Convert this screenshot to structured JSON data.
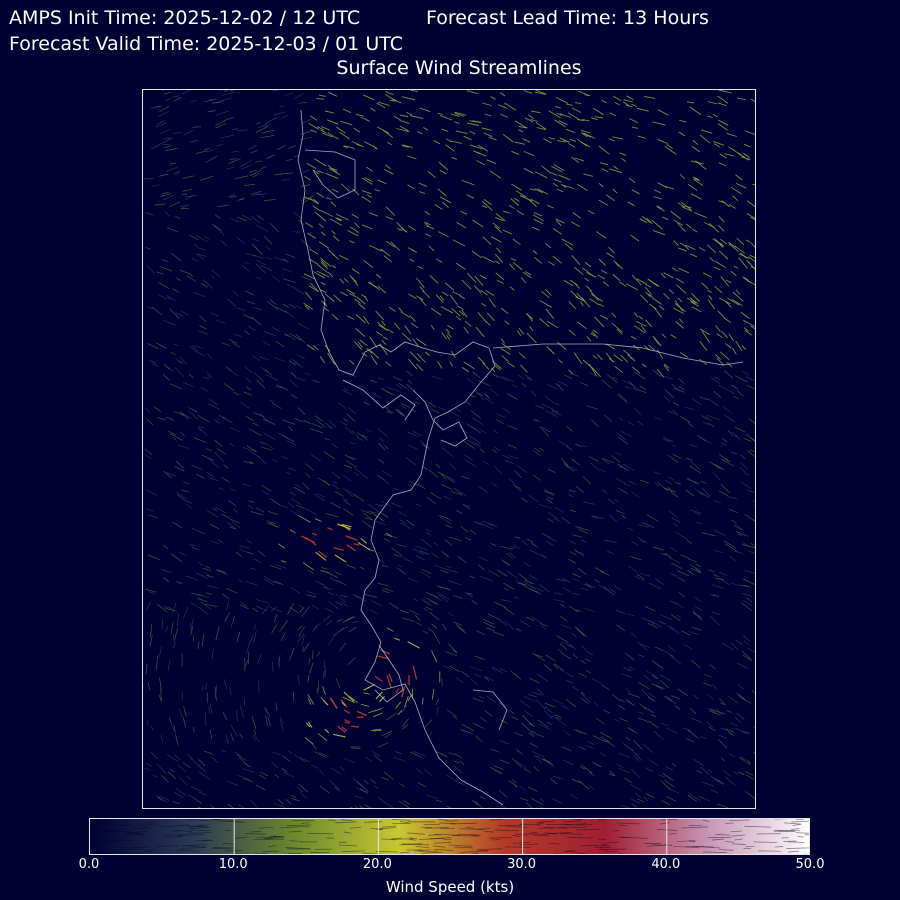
{
  "header": {
    "init_time": "AMPS Init Time: 2025-12-02 / 12 UTC",
    "lead_time": "Forecast Lead Time: 13 Hours",
    "valid_time": "Forecast Valid Time: 2025-12-03 / 01 UTC",
    "title": "Surface Wind Streamlines"
  },
  "colorbar": {
    "label": "Wind Speed (kts)",
    "ticks": [
      "0.0",
      "10.0",
      "20.0",
      "30.0",
      "40.0",
      "50.0"
    ],
    "range": [
      0,
      50
    ],
    "colors": [
      "#000033",
      "#2a3a55",
      "#6d8a2e",
      "#c8c832",
      "#b43c28",
      "#a01e32",
      "#c896b4",
      "#ffffff"
    ]
  },
  "map": {
    "background": "#000033",
    "coastline_color": "#c8c8d2",
    "wind_field": "streamlines"
  }
}
